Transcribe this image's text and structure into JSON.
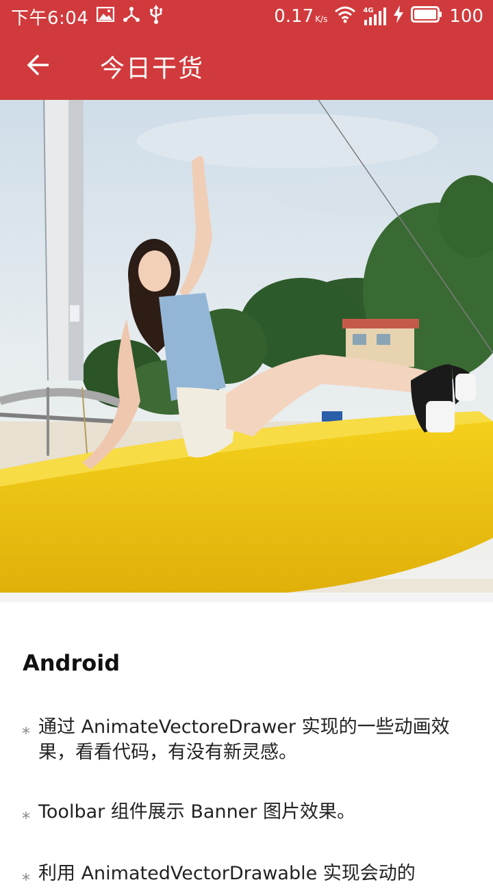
{
  "status_bar": {
    "time": "下午6:04",
    "net_speed": "0.17",
    "net_unit": "K/s",
    "network": "4G",
    "battery": "100"
  },
  "app_bar": {
    "title": "今日干货"
  },
  "icons": [
    "back-arrow-icon",
    "gallery-icon",
    "share-icon",
    "usb-icon",
    "wifi-icon",
    "signal-icon",
    "charging-icon",
    "battery-icon"
  ],
  "colors": {
    "primary": "#d13a3c",
    "background": "#ffffff"
  },
  "section": {
    "title": "Android",
    "items": [
      "通过 AnimateVectoreDrawer 实现的一些动画效果，看看代码，有没有新灵感。",
      "Toolbar 组件展示 Banner 图片效果。",
      "利用 AnimatedVectorDrawable 实现会动的"
    ],
    "bullet": "*"
  }
}
